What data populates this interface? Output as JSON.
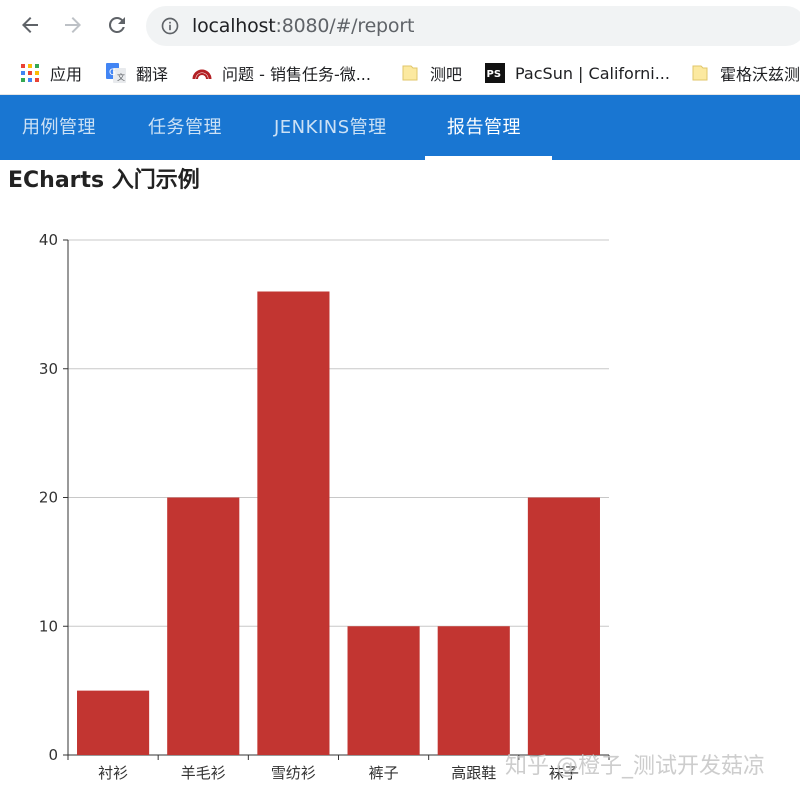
{
  "browser": {
    "url_host": "localhost",
    "url_rest": ":8080/#/report"
  },
  "bookmarks": [
    {
      "label": "应用",
      "icon": "apps-grid-icon"
    },
    {
      "label": "翻译",
      "icon": "google-translate-icon"
    },
    {
      "label": "问题 - 销售任务-微...",
      "icon": "redmine-icon"
    },
    {
      "label": "测吧",
      "icon": "folder-icon"
    },
    {
      "label": "PacSun | Californi...",
      "icon": "pacsun-icon"
    },
    {
      "label": "霍格沃兹测",
      "icon": "folder-icon"
    }
  ],
  "appnav": {
    "tabs": [
      {
        "label": "用例管理",
        "active": false
      },
      {
        "label": "任务管理",
        "active": false
      },
      {
        "label": "JENKINS管理",
        "active": false
      },
      {
        "label": "报告管理",
        "active": true
      }
    ],
    "background": "#1976d2"
  },
  "page": {
    "title": "ECharts 入门示例"
  },
  "chart_data": {
    "type": "bar",
    "title": "",
    "categories": [
      "衬衫",
      "羊毛衫",
      "雪纺衫",
      "裤子",
      "高跟鞋",
      "袜子"
    ],
    "values": [
      5,
      20,
      36,
      10,
      10,
      20
    ],
    "ylim": [
      0,
      40
    ],
    "yticks": [
      0,
      10,
      20,
      30,
      40
    ],
    "grid": true,
    "legend": "none",
    "color": "#c23531"
  },
  "watermark": "知乎 @橙子_测试开发菇凉"
}
